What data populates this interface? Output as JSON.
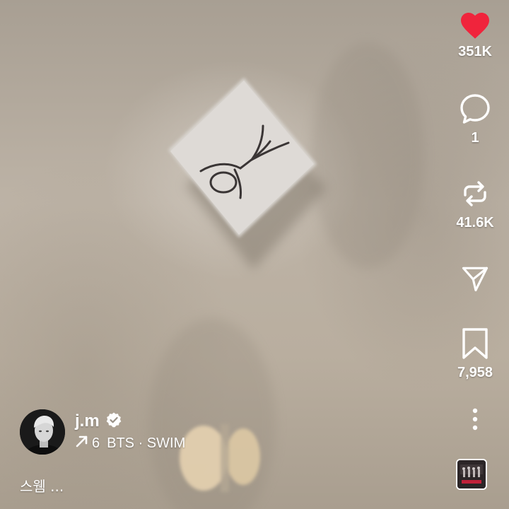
{
  "actions": {
    "like_count": "351K",
    "comment_count": "1",
    "repost_count": "41.6K",
    "bookmark_count": "7,958"
  },
  "creator": {
    "username": "j.m",
    "music_count": "6",
    "music_title": "BTS · SWIM",
    "caption": "스웸 ..."
  },
  "colors": {
    "like": "#f0243c",
    "text": "#ffffff"
  },
  "icons": [
    "heart-icon",
    "comment-icon",
    "repost-icon",
    "share-icon",
    "bookmark-icon",
    "more-icon",
    "verified-icon",
    "trend-arrow-icon"
  ]
}
